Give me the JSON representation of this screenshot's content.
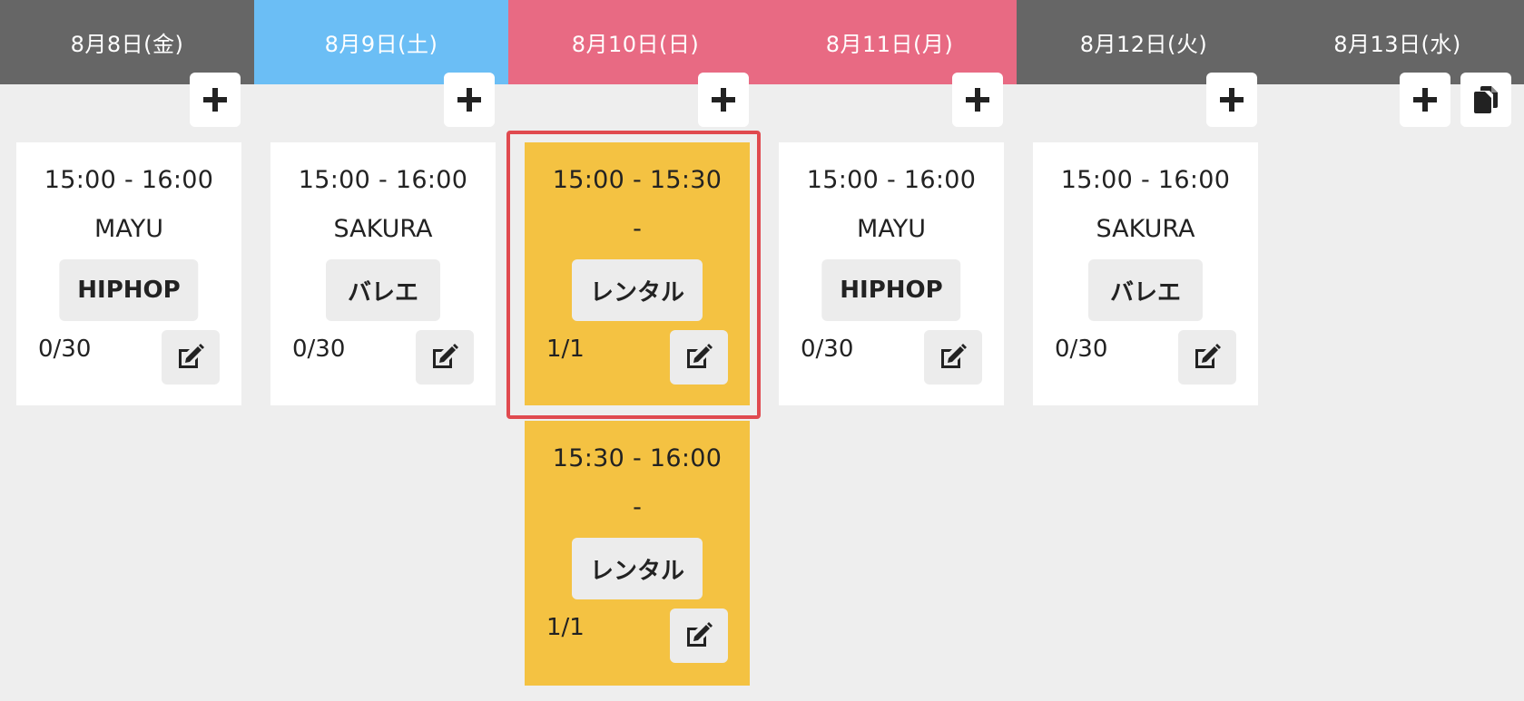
{
  "colors": {
    "weekday": "#666666",
    "saturday": "#6bbef5",
    "holiday": "#e86a83",
    "rental_card": "#f4c242",
    "card": "#ffffff",
    "highlight": "#e04a4f"
  },
  "days": [
    {
      "label": "8月8日(金)",
      "type": "weekday"
    },
    {
      "label": "8月9日(土)",
      "type": "saturday"
    },
    {
      "label": "8月10日(日)",
      "type": "holiday"
    },
    {
      "label": "8月11日(月)",
      "type": "holiday"
    },
    {
      "label": "8月12日(火)",
      "type": "weekday"
    },
    {
      "label": "8月13日(水)",
      "type": "weekday"
    }
  ],
  "icons": {
    "add": "plus-icon",
    "copy": "copy-icon",
    "edit": "edit-icon"
  },
  "lessons": [
    {
      "time": "15:00 - 16:00",
      "instructor": "MAYU",
      "genre": "HIPHOP",
      "capacity": "0/30",
      "rental": false
    },
    {
      "time": "15:00 - 16:00",
      "instructor": "SAKURA",
      "genre": "バレエ",
      "capacity": "0/30",
      "rental": false
    },
    {
      "time": "15:00 - 15:30",
      "instructor": "-",
      "genre": "レンタル",
      "capacity": "1/1",
      "rental": true
    },
    {
      "time": "15:30 - 16:00",
      "instructor": "-",
      "genre": "レンタル",
      "capacity": "1/1",
      "rental": true
    },
    {
      "time": "15:00 - 16:00",
      "instructor": "MAYU",
      "genre": "HIPHOP",
      "capacity": "0/30",
      "rental": false
    },
    {
      "time": "15:00 - 16:00",
      "instructor": "SAKURA",
      "genre": "バレエ",
      "capacity": "0/30",
      "rental": false
    }
  ]
}
